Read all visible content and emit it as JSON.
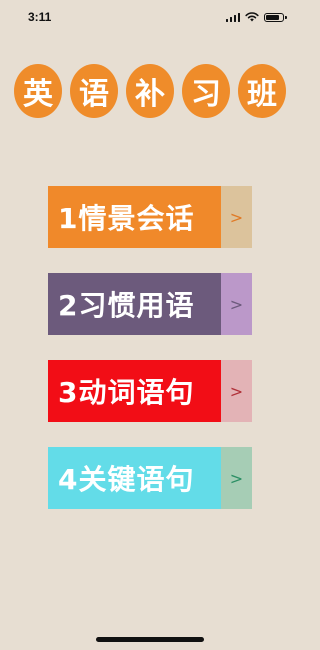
{
  "status_bar": {
    "time": "3:11",
    "icons": [
      "signal-icon",
      "wifi-icon",
      "battery-icon"
    ],
    "battery_level": 0.85
  },
  "title": {
    "characters": [
      "英",
      "语",
      "补",
      "习",
      "班"
    ],
    "bubble_color": "#ef8c2a"
  },
  "menu": {
    "items": [
      {
        "label": "1情景会话",
        "arrow": ">",
        "color": "#f0892a",
        "tab_color": "#dcc39c",
        "arrow_color": "#e07a26"
      },
      {
        "label": "2习惯用语",
        "arrow": ">",
        "color": "#6c5a7c",
        "tab_color": "#bb98c9",
        "arrow_color": "#6c5a7c"
      },
      {
        "label": "3动词语句",
        "arrow": ">",
        "color": "#f20d16",
        "tab_color": "#e3b3b6",
        "arrow_color": "#b03038"
      },
      {
        "label": "4关键语句",
        "arrow": ">",
        "color": "#63dce8",
        "tab_color": "#a6cdb5",
        "arrow_color": "#2b8f64"
      }
    ]
  }
}
